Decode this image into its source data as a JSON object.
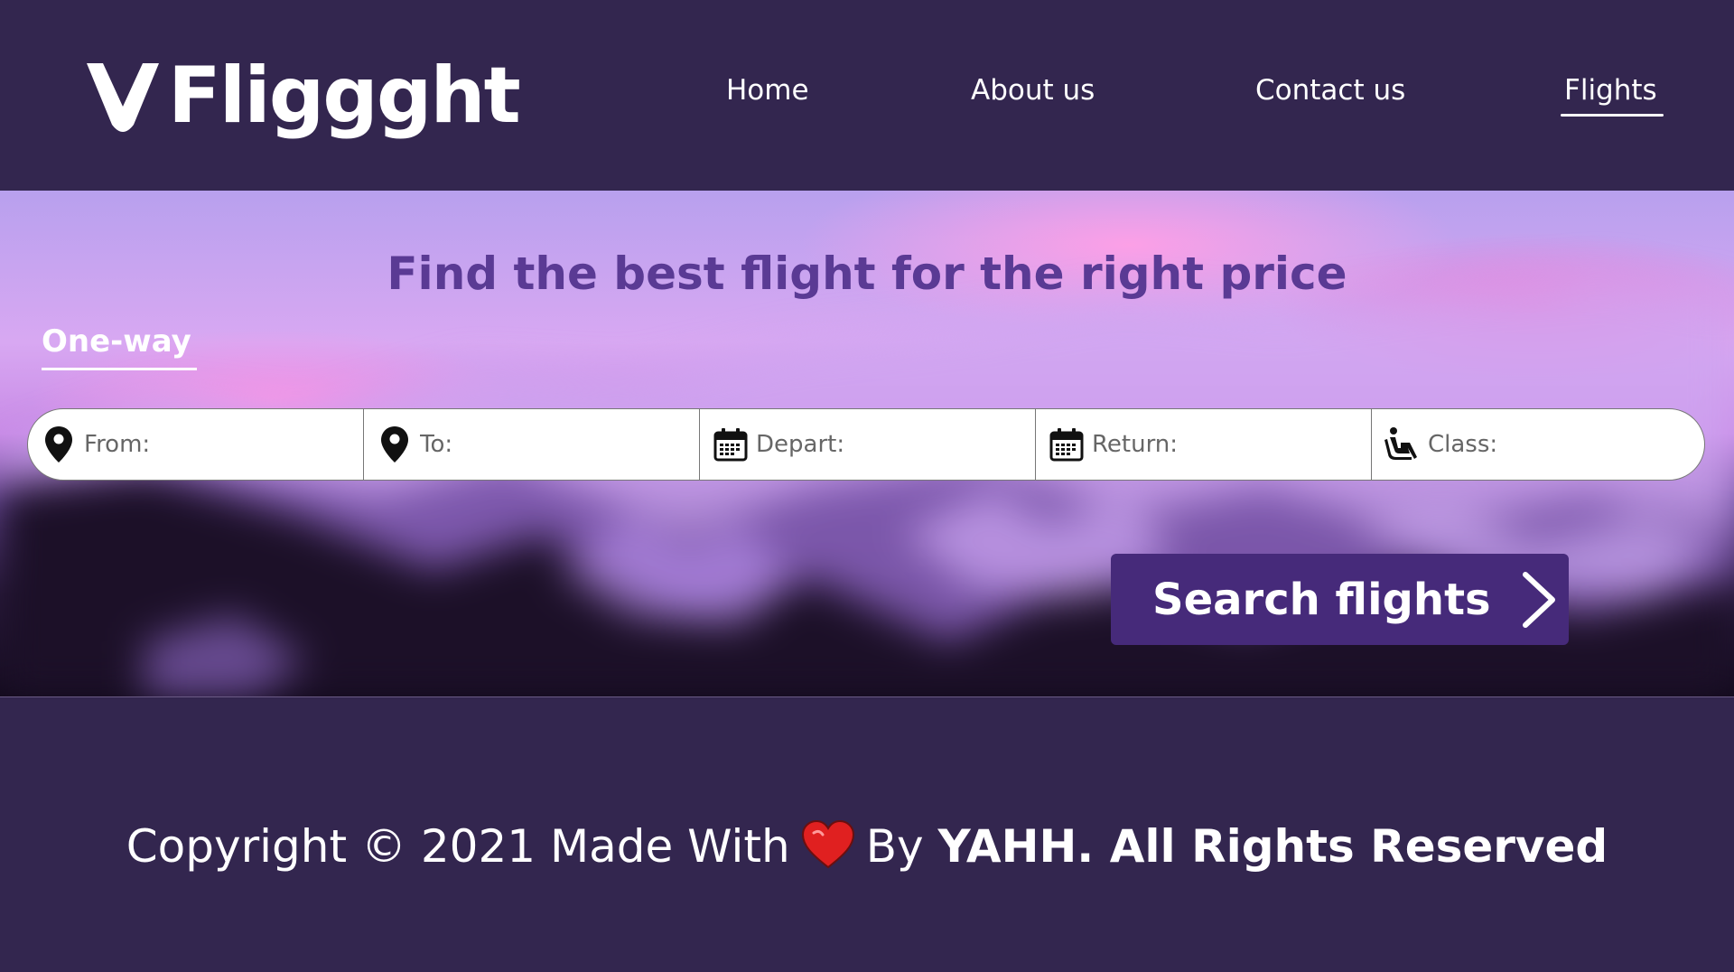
{
  "brand": {
    "name": "Fliggght"
  },
  "nav": {
    "items": [
      {
        "label": "Home"
      },
      {
        "label": "About us"
      },
      {
        "label": "Contact us"
      },
      {
        "label": "Flights",
        "active": true
      }
    ]
  },
  "hero": {
    "title": "Find the best flight for the right price",
    "trip_tab": "One-way"
  },
  "search": {
    "fields": [
      {
        "placeholder": "From:",
        "icon": "location-pin-icon"
      },
      {
        "placeholder": "To:",
        "icon": "location-pin-icon"
      },
      {
        "placeholder": "Depart:",
        "icon": "calendar-icon"
      },
      {
        "placeholder": "Return:",
        "icon": "calendar-icon"
      },
      {
        "placeholder": "Class:",
        "icon": "seat-icon"
      }
    ],
    "button_label": "Search flights"
  },
  "footer": {
    "copyright_prefix": "Copyright © 2021 Made With",
    "by": "By",
    "owner": "YAHH. All Rights Reserved"
  },
  "colors": {
    "background": "#33264f",
    "accent": "#462a7a",
    "title": "#5a3a94",
    "heart": "#e02020"
  }
}
